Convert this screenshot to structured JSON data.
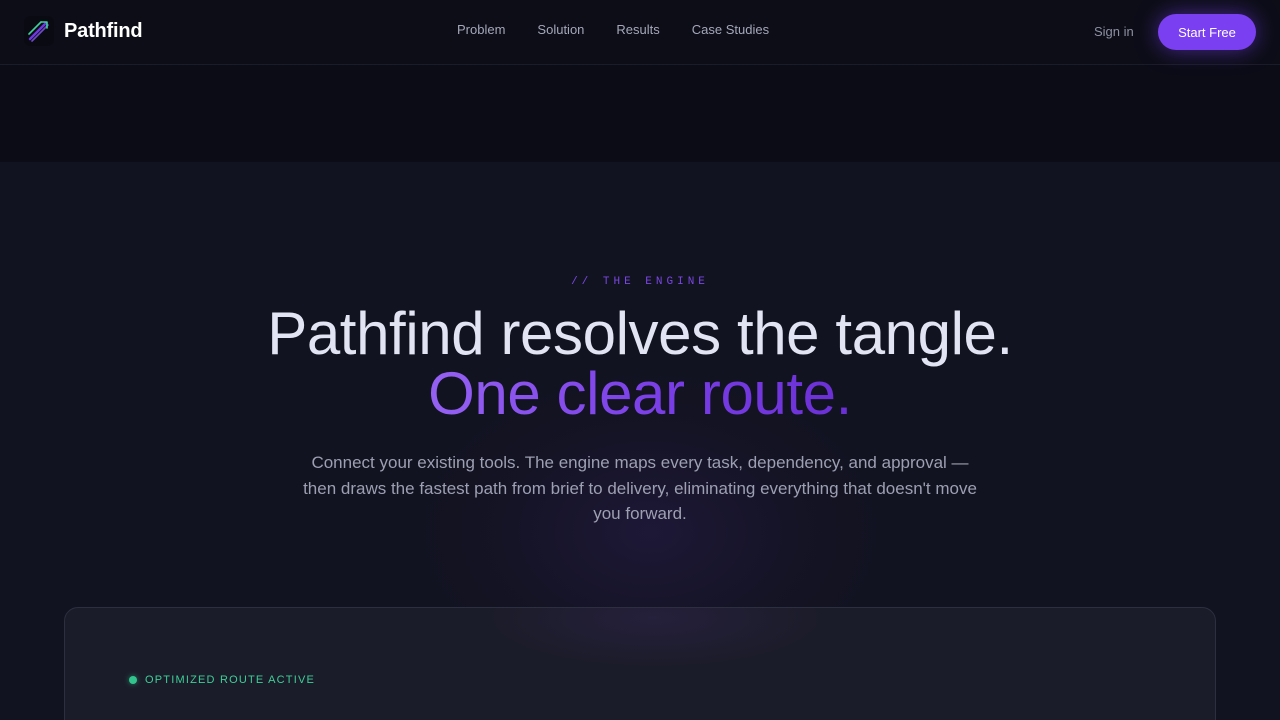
{
  "nav": {
    "brand": "Pathfind",
    "logo_icon": "pathfind-logo-icon",
    "links": [
      "Problem",
      "Solution",
      "Results",
      "Case Studies"
    ],
    "sign_in": "Sign in",
    "cta": "Start Free"
  },
  "hero": {
    "eyebrow": "// THE ENGINE",
    "headline": "Pathfind resolves the tangle.",
    "headline_accent": "One clear route.",
    "subcopy": "Connect your existing tools. The engine maps every task, dependency, and approval — then draws the fastest path from brief to delivery, eliminating everything that doesn't move you forward."
  },
  "preview": {
    "status": "OPTIMIZED ROUTE ACTIVE",
    "status_color": "#31c48d"
  },
  "colors": {
    "accent": "#7b3ff2",
    "background": "#0d0e18",
    "hero_background": "#121320"
  }
}
